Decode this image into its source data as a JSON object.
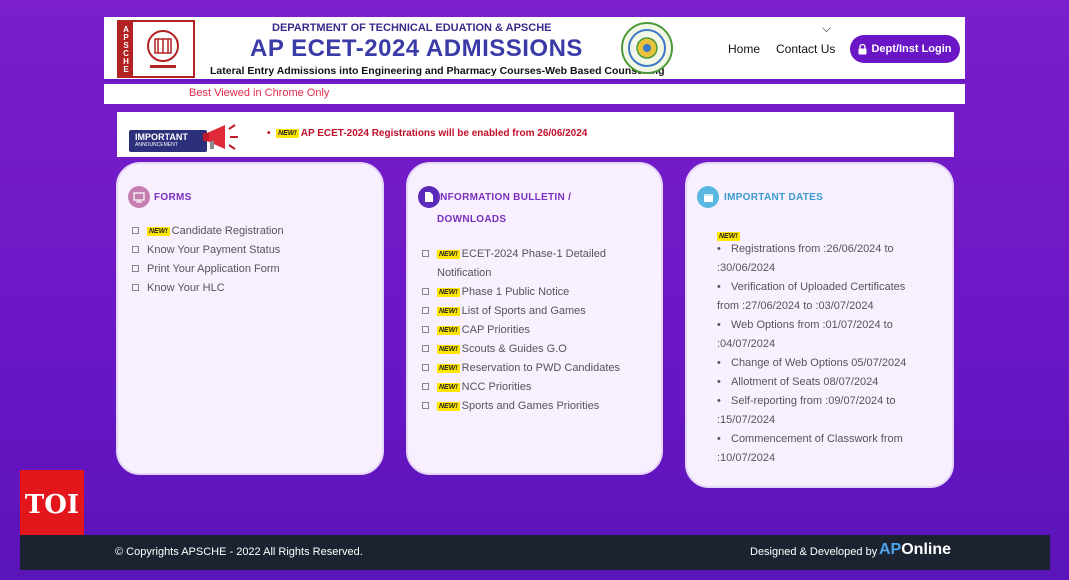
{
  "header": {
    "logo_side_text": "APSCHE",
    "department": "DEPARTMENT OF TECHNICAL EDUATION & APSCHE",
    "title": "AP ECET-2024 ADMISSIONS",
    "subtitle": "Lateral Entry Admissions into Engineering and Pharmacy Courses-Web Based Counselling",
    "nav": {
      "home": "Home",
      "contact": "Contact Us",
      "login": "Dept/Inst Login"
    }
  },
  "notice_bar": {
    "text": "Best Viewed in Chrome Only"
  },
  "announcement": {
    "badge_title": "IMPORTANT",
    "badge_sub": "ANNOUNCEMENT",
    "new_tag": "NEW!",
    "text": "AP ECET-2024 Registrations will be enabled from 26/06/2024"
  },
  "forms": {
    "title": "FORMS",
    "items": [
      {
        "label": "Candidate Registration",
        "is_new": true
      },
      {
        "label": "Know Your Payment Status",
        "is_new": false
      },
      {
        "label": "Print Your Application Form",
        "is_new": false
      },
      {
        "label": "Know Your HLC",
        "is_new": false
      }
    ]
  },
  "info_bulletin": {
    "title_line1": "INFORMATION BULLETIN /",
    "title_line2": "DOWNLOADS",
    "items": [
      {
        "label": "ECET-2024 Phase-1 Detailed",
        "label2": "Notification"
      },
      {
        "label": "Phase 1 Public Notice"
      },
      {
        "label": "List of Sports and Games"
      },
      {
        "label": "CAP Priorities"
      },
      {
        "label": "Scouts & Guides G.O"
      },
      {
        "label": "Reservation to PWD Candidates"
      },
      {
        "label": "NCC Priorities"
      },
      {
        "label": "Sports and Games Priorities"
      }
    ]
  },
  "important_dates": {
    "title": "IMPORTANT DATES",
    "new_tag": "NEW!",
    "items": [
      {
        "line1": "Registrations from :26/06/2024 to",
        "line2": ":30/06/2024"
      },
      {
        "line1": "Verification of Uploaded Certificates",
        "line2": "from :27/06/2024 to :03/07/2024"
      },
      {
        "line1": "Web Options from :01/07/2024 to",
        "line2": ":04/07/2024"
      },
      {
        "line1": "Change of Web Options 05/07/2024"
      },
      {
        "line1": "Allotment of Seats 08/07/2024"
      },
      {
        "line1": "Self-reporting from :09/07/2024 to",
        "line2": ":15/07/2024"
      },
      {
        "line1": "Commencement of Classwork from",
        "line2": ":10/07/2024"
      }
    ]
  },
  "watermark": {
    "text": "TOI"
  },
  "footer": {
    "copyright": "© Copyrights APSCHE - 2022 All Rights Reserved.",
    "designed_by": "Designed & Developed by",
    "brand_ap": "AP",
    "brand_rest": "Online"
  },
  "colors": {
    "primary_purple": "#6a16c6",
    "card_bg": "#f8f0ff",
    "accent_red": "#e0264a",
    "footer_bg": "#1c2330"
  }
}
